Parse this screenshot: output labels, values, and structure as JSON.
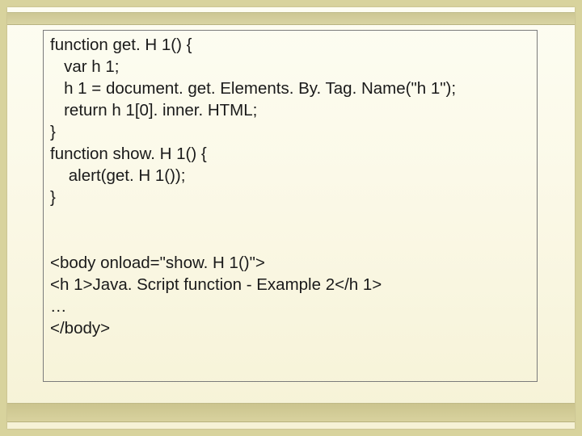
{
  "code": {
    "lines": [
      "function get. H 1() {",
      "   var h 1;",
      "   h 1 = document. get. Elements. By. Tag. Name(\"h 1\");",
      "   return h 1[0]. inner. HTML;",
      "}",
      "function show. H 1() {",
      "    alert(get. H 1());",
      "}",
      "",
      "",
      "<body onload=\"show. H 1()\">",
      "<h 1>Java. Script function - Example 2</h 1>",
      "…",
      "</body>"
    ]
  }
}
